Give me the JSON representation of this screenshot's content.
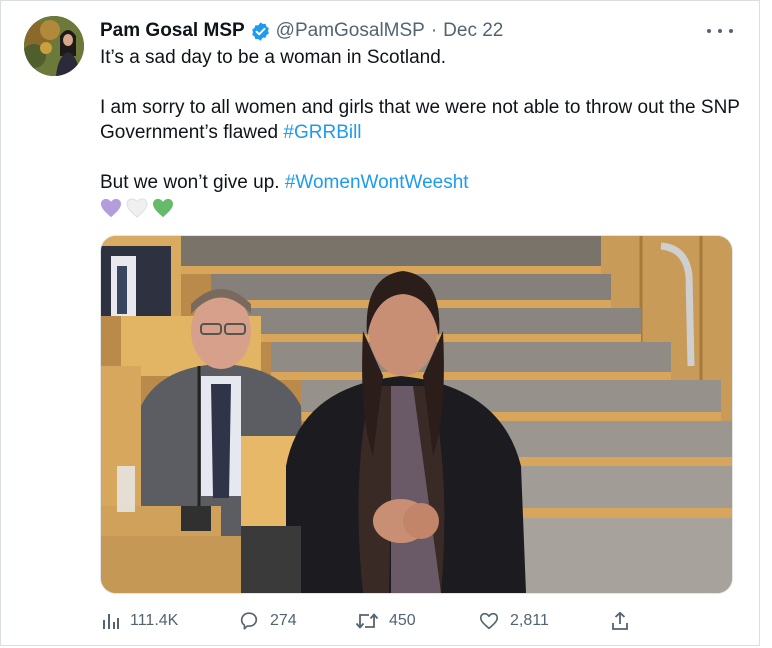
{
  "tweet": {
    "display_name": "Pam Gosal MSP",
    "handle": "@PamGosalMSP",
    "separator": "·",
    "date": "Dec 22",
    "lines": [
      "It’s a sad day to be a woman in Scotland.",
      "I am sorry to all women and girls that we were not able to throw out the SNP Government’s flawed ",
      "#GRRBill",
      "But we won’t give up. ",
      "#WomenWontWeesht"
    ],
    "hearts": [
      "purple-heart",
      "white-heart",
      "green-heart"
    ]
  },
  "colors": {
    "link": "#1d9bf0",
    "verified": "#1d9bf0",
    "secondary_text": "#536471",
    "heart_purple": "#b39ddb",
    "heart_white": "#f0f0f0",
    "heart_green": "#66bb6a"
  },
  "actions": {
    "views": "111.4K",
    "replies": "274",
    "retweets": "450",
    "likes": "2,811"
  },
  "icons": {
    "views": "bar-chart-icon",
    "reply": "speech-bubble-icon",
    "retweet": "retweet-arrows-icon",
    "like": "heart-outline-icon",
    "share": "share-upload-icon",
    "more": "more-dots-icon",
    "verified": "verified-badge-icon"
  }
}
